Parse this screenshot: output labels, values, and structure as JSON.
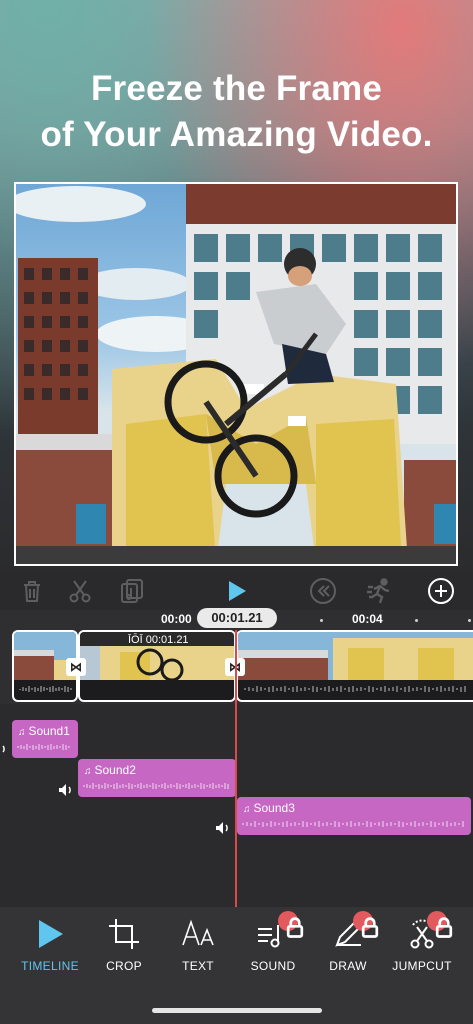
{
  "promo": {
    "headline_line1": "Freeze the Frame",
    "headline_line2": "of Your Amazing Video."
  },
  "toolbar": {
    "icons": [
      "trash-icon",
      "scissors-icon",
      "music-file-icon",
      "play-icon",
      "rewind-icon",
      "speed-icon",
      "add-icon"
    ]
  },
  "timeline": {
    "ruler_start": "00:00",
    "current_time": "00:01.21",
    "ruler_mark": "00:04",
    "clip_badge": "00:01.21"
  },
  "audio": {
    "tracks": [
      {
        "label": "Sound1"
      },
      {
        "label": "Sound2"
      },
      {
        "label": "Sound3"
      }
    ]
  },
  "tabs": [
    {
      "label": "TIMELINE",
      "active": true
    },
    {
      "label": "CROP",
      "active": false
    },
    {
      "label": "TEXT",
      "active": false
    },
    {
      "label": "SOUND",
      "active": false,
      "locked": true
    },
    {
      "label": "DRAW",
      "active": false,
      "locked": true
    },
    {
      "label": "JUMPCUT",
      "active": false,
      "locked": true
    }
  ],
  "colors": {
    "accent": "#5ec6ef",
    "sound_clip": "#c767c4",
    "playhead": "#d94b4b",
    "lock_badge": "#e25a5e"
  }
}
